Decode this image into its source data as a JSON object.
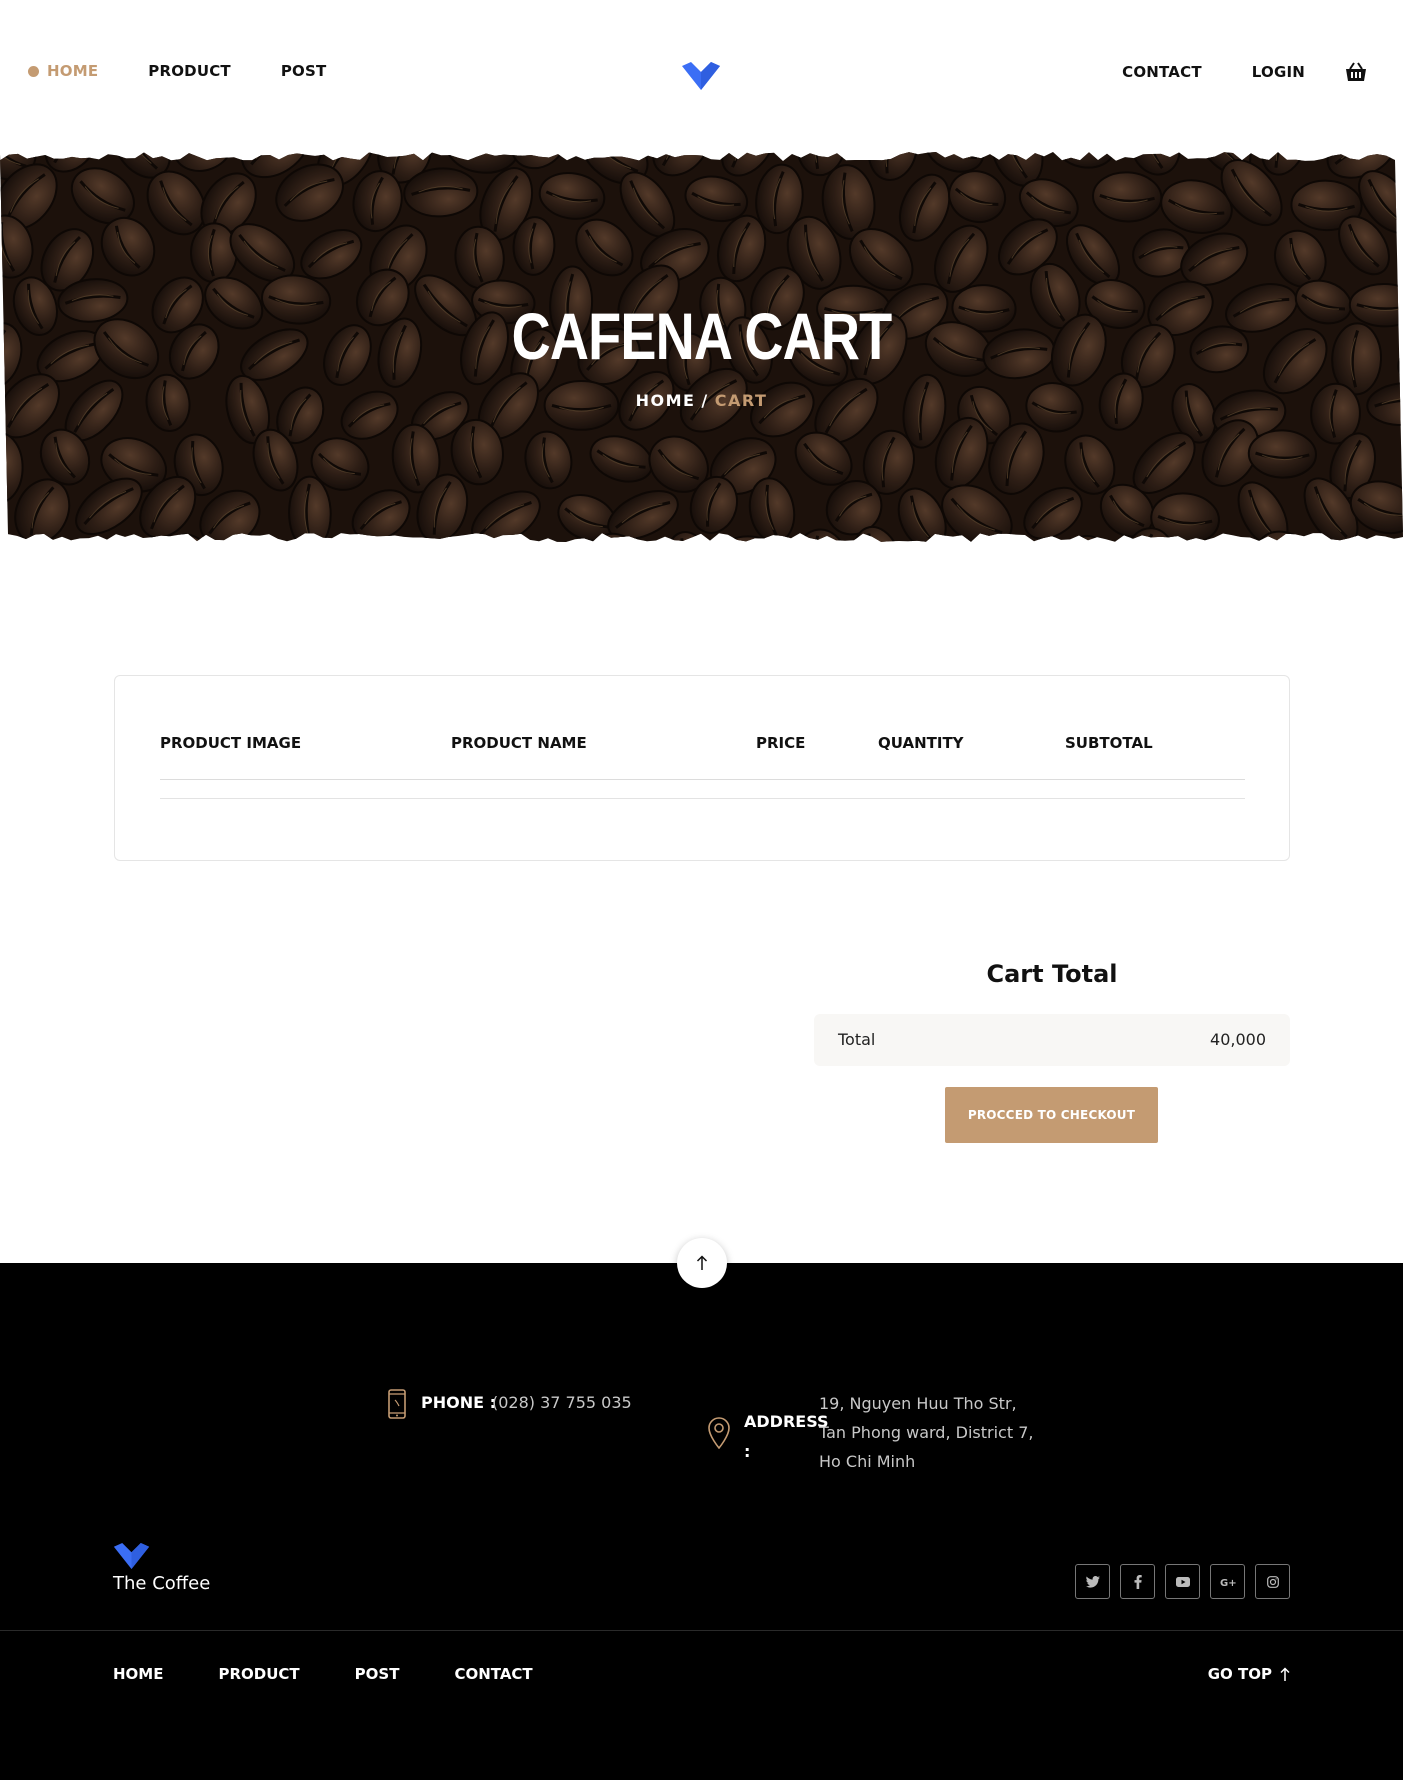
{
  "header": {
    "nav_left": [
      "HOME",
      "PRODUCT",
      "POST"
    ],
    "nav_right": [
      "CONTACT",
      "LOGIN"
    ],
    "active": "HOME",
    "cart_icon": "basket-icon",
    "logo_icon": "chevron-heart-logo"
  },
  "hero": {
    "title": "CAFENA CART",
    "breadcrumb_home": "HOME",
    "breadcrumb_sep": "/",
    "breadcrumb_current": "CART"
  },
  "cart": {
    "columns": [
      "PRODUCT IMAGE",
      "PRODUCT NAME",
      "PRICE",
      "QUANTITY",
      "SUBTOTAL"
    ]
  },
  "cart_total": {
    "title": "Cart Total",
    "total_label": "Total",
    "total_value": "40,000",
    "checkout_label": "PROCCED TO CHECKOUT"
  },
  "footer": {
    "phone_label": "PHONE :",
    "phone_value": "(028) 37 755 035",
    "address_label": "ADDRESS :",
    "address_value": "19, Nguyen Huu Tho Str, Tan Phong ward, District 7, Ho Chi Minh",
    "brand": "The Coffee",
    "socials": [
      "twitter-icon",
      "facebook-icon",
      "youtube-icon",
      "google-plus-icon",
      "instagram-icon"
    ],
    "nav": [
      "HOME",
      "PRODUCT",
      "POST",
      "CONTACT"
    ],
    "go_top": "GO TOP"
  },
  "colors": {
    "accent": "#c49b72",
    "logo_blue": "#3b6ef5",
    "footer_bg": "#000000",
    "total_row_bg": "#f8f7f5"
  }
}
